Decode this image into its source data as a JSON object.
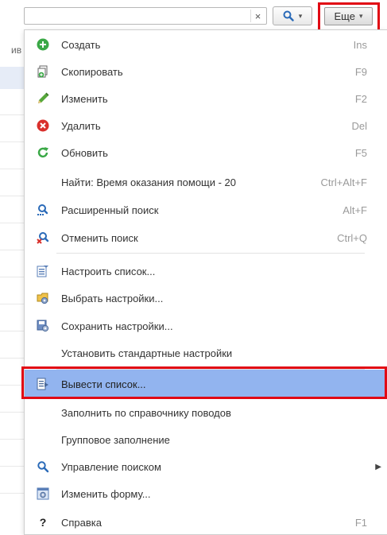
{
  "toolbar": {
    "search_value": "",
    "clear_label": "×",
    "find_caret": "▾",
    "more_label": "Еще",
    "more_caret": "▾"
  },
  "background": {
    "header_fragment": "ив"
  },
  "menu": {
    "items": [
      {
        "label": "Создать",
        "shortcut": "Ins",
        "icon": "add-icon"
      },
      {
        "label": "Скопировать",
        "shortcut": "F9",
        "icon": "copy-icon"
      },
      {
        "label": "Изменить",
        "shortcut": "F2",
        "icon": "pencil-icon"
      },
      {
        "label": "Удалить",
        "shortcut": "Del",
        "icon": "delete-icon"
      },
      {
        "label": "Обновить",
        "shortcut": "F5",
        "icon": "refresh-icon"
      },
      {
        "label": "Найти: Время оказания помощи - 20",
        "shortcut": "Ctrl+Alt+F",
        "icon": ""
      },
      {
        "label": "Расширенный поиск",
        "shortcut": "Alt+F",
        "icon": "advanced-search-icon"
      },
      {
        "label": "Отменить поиск",
        "shortcut": "Ctrl+Q",
        "icon": "cancel-search-icon"
      },
      {
        "label": "Настроить список...",
        "shortcut": "",
        "icon": "list-settings-icon"
      },
      {
        "label": "Выбрать настройки...",
        "shortcut": "",
        "icon": "choose-settings-icon"
      },
      {
        "label": "Сохранить настройки...",
        "shortcut": "",
        "icon": "save-settings-icon"
      },
      {
        "label": "Установить стандартные настройки",
        "shortcut": "",
        "icon": ""
      },
      {
        "label": "Вывести список...",
        "shortcut": "",
        "icon": "output-list-icon",
        "selected": true
      },
      {
        "label": "Заполнить по справочнику поводов",
        "shortcut": "",
        "icon": ""
      },
      {
        "label": "Групповое заполнение",
        "shortcut": "",
        "icon": ""
      },
      {
        "label": "Управление поиском",
        "shortcut": "",
        "icon": "search-icon",
        "submenu_arrow": "▶"
      },
      {
        "label": "Изменить форму...",
        "shortcut": "",
        "icon": "change-form-icon"
      },
      {
        "label": "Справка",
        "shortcut": "F1",
        "icon": "help-icon",
        "icon_glyph": "?"
      }
    ]
  },
  "colors": {
    "selected_bg": "#92b4ef",
    "highlight_border": "#e10914",
    "add_green": "#3aa846",
    "delete_red": "#d9302c",
    "search_blue": "#2a6ab8"
  }
}
